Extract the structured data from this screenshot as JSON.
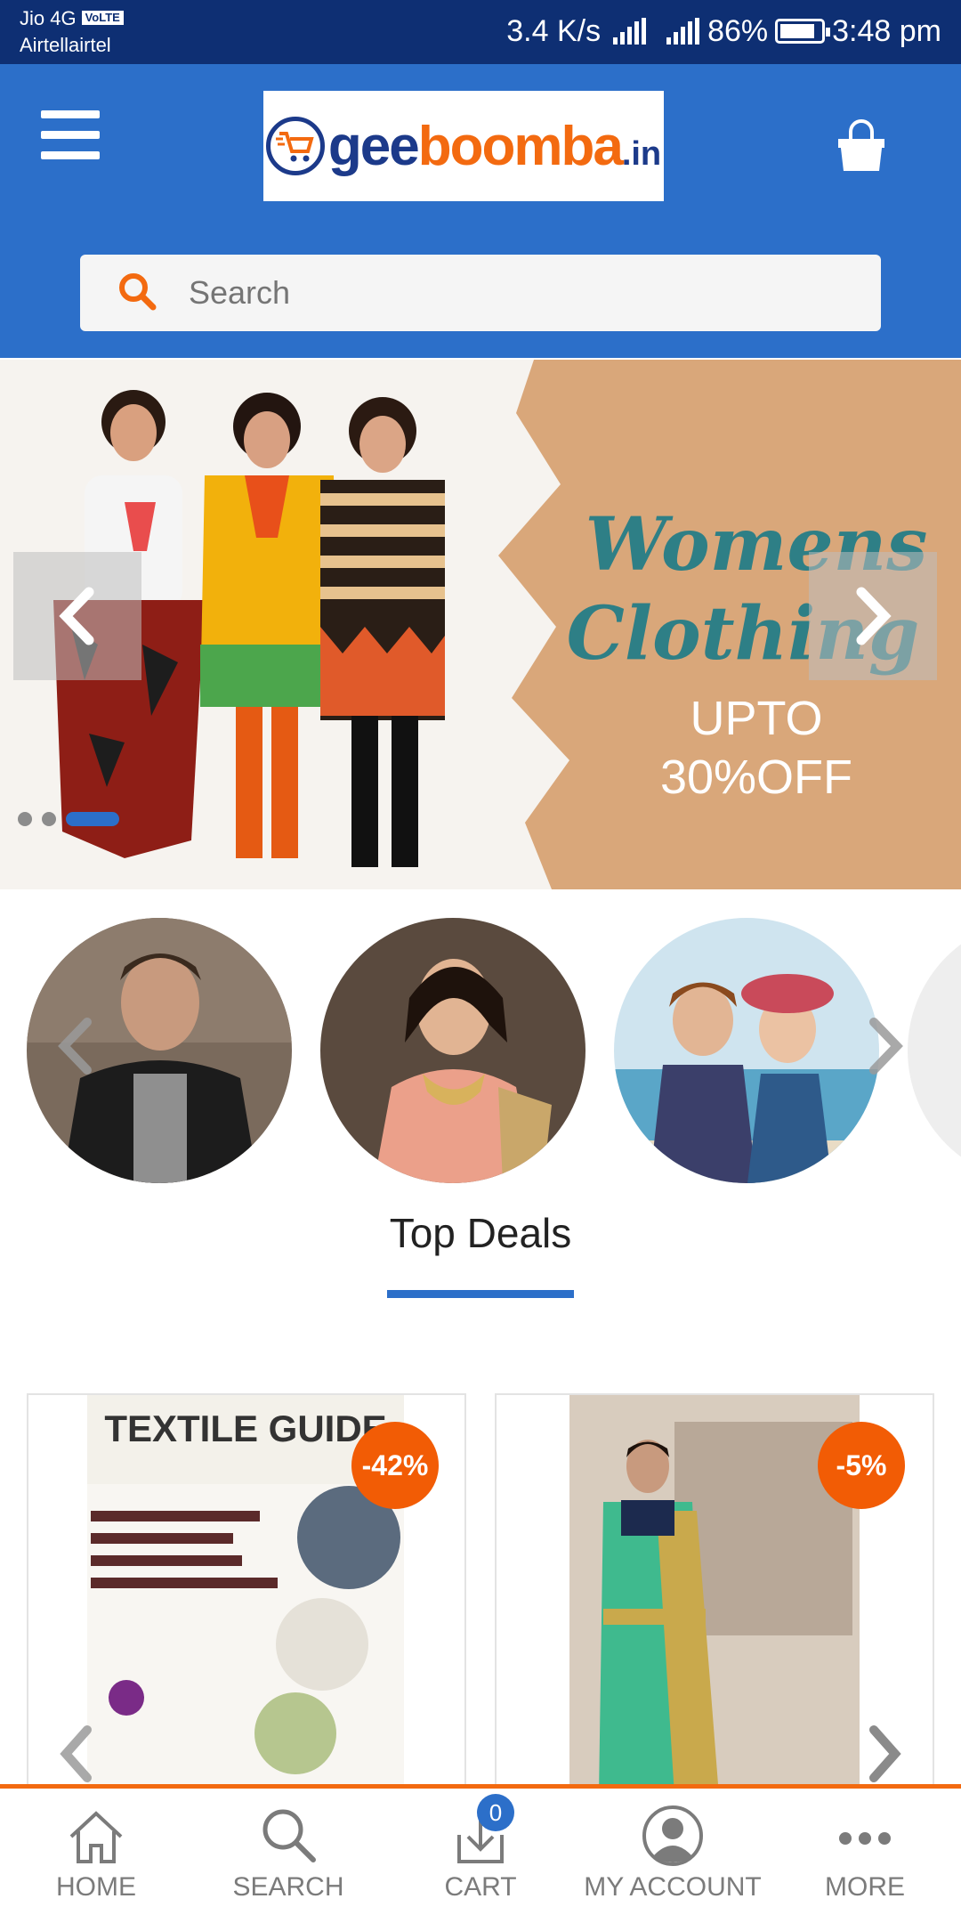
{
  "status_bar": {
    "carrier1": "Jio 4G",
    "volte": "VoLTE",
    "carrier2": "Airtellairtel",
    "speed": "3.4 K/s",
    "battery": "86%",
    "battery_level": 0.86,
    "time": "3:48 pm"
  },
  "header": {
    "logo": "geeboomba.in",
    "logo_parts": {
      "a": "gee",
      "b": "boomba",
      "c": ".in"
    },
    "search_placeholder": "Search",
    "colors": {
      "primary": "#2c6fc9",
      "accent": "#f36a10",
      "status_bar": "#0e2f73"
    }
  },
  "banner": {
    "title_line1": "Womens",
    "title_line2": "Clothing",
    "offer_line1": "UPTO",
    "offer_line2": "30%OFF",
    "slides": 3,
    "active_slide": 3
  },
  "categories": [
    {
      "icon": "men-photo"
    },
    {
      "icon": "women-photo"
    },
    {
      "icon": "kids-photo"
    }
  ],
  "top_deals": {
    "title": "Top Deals",
    "items": [
      {
        "image_title": "TEXTILE GUIDE",
        "discount": "-42%"
      },
      {
        "image_title": "saree-photo",
        "discount": "-5%"
      }
    ]
  },
  "bottom_nav": {
    "items": [
      {
        "label": "HOME",
        "icon": "home-icon"
      },
      {
        "label": "SEARCH",
        "icon": "search-icon"
      },
      {
        "label": "CART",
        "icon": "cart-icon",
        "badge": "0"
      },
      {
        "label": "MY ACCOUNT",
        "icon": "account-icon"
      },
      {
        "label": "MORE",
        "icon": "more-icon"
      }
    ]
  }
}
